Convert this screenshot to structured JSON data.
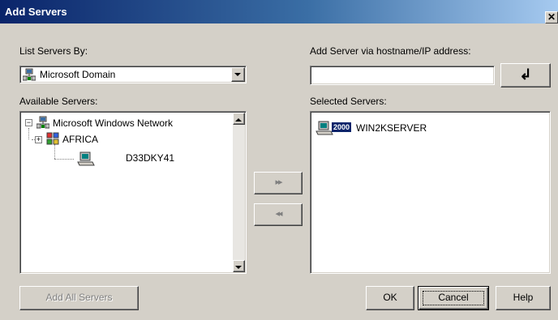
{
  "window": {
    "title": "Add Servers",
    "close_glyph": "✕"
  },
  "list_by": {
    "label": "List Servers By:",
    "selected": "Microsoft Domain"
  },
  "hostname": {
    "label": "Add Server via hostname/IP address:",
    "value": "",
    "enter_glyph": "↲"
  },
  "available": {
    "label": "Available Servers:",
    "tree": [
      {
        "label": "Microsoft Windows Network",
        "expanded": true
      },
      {
        "label": "AFRICA",
        "expanded": false
      },
      {
        "label": "D33DKY41"
      }
    ]
  },
  "selected": {
    "label": "Selected Servers:",
    "items": [
      {
        "badge": "2000",
        "label": "WIN2KSERVER"
      }
    ]
  },
  "transfer": {
    "add_glyph": "▸▸",
    "remove_glyph": "◂◂"
  },
  "buttons": {
    "add_all": "Add All Servers",
    "ok": "OK",
    "cancel": "Cancel",
    "help": "Help"
  },
  "colors": {
    "title_start": "#0a246a",
    "title_end": "#a6caf0",
    "face": "#d4d0c8",
    "badge": "#0a246a"
  }
}
